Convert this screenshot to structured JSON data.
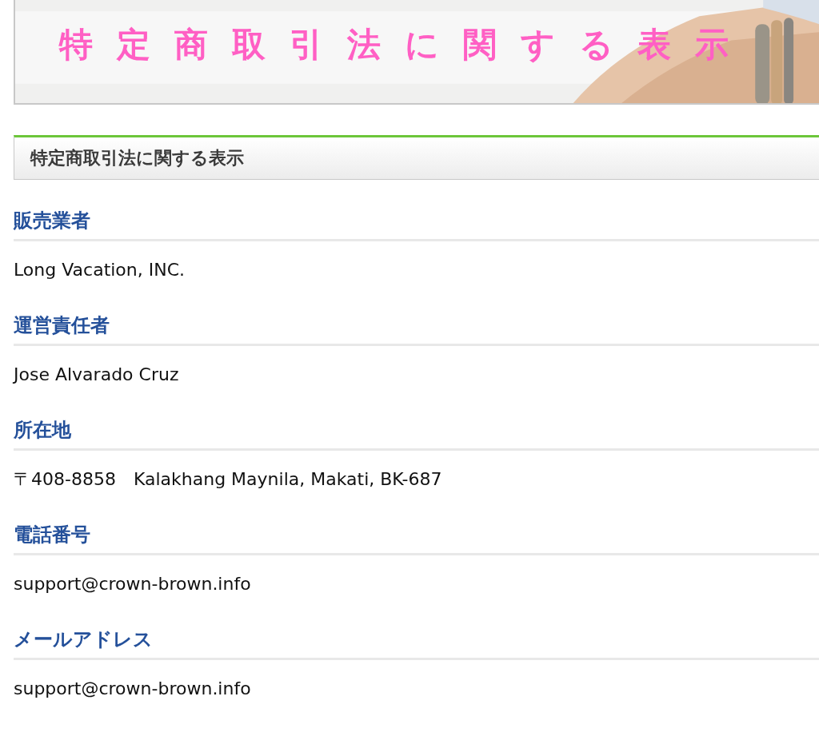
{
  "banner": {
    "title": "特定商取引法に関する表示"
  },
  "section": {
    "title": "特定商取引法に関する表示"
  },
  "items": [
    {
      "label": "販売業者",
      "value": "Long Vacation, INC."
    },
    {
      "label": "運営責任者",
      "value": "Jose Alvarado Cruz"
    },
    {
      "label": "所在地",
      "value": "〒408-8858　Kalakhang Maynila, Makati, BK-687"
    },
    {
      "label": "電話番号",
      "value": "support@crown-brown.info"
    },
    {
      "label": "メールアドレス",
      "value": "support@crown-brown.info"
    }
  ]
}
